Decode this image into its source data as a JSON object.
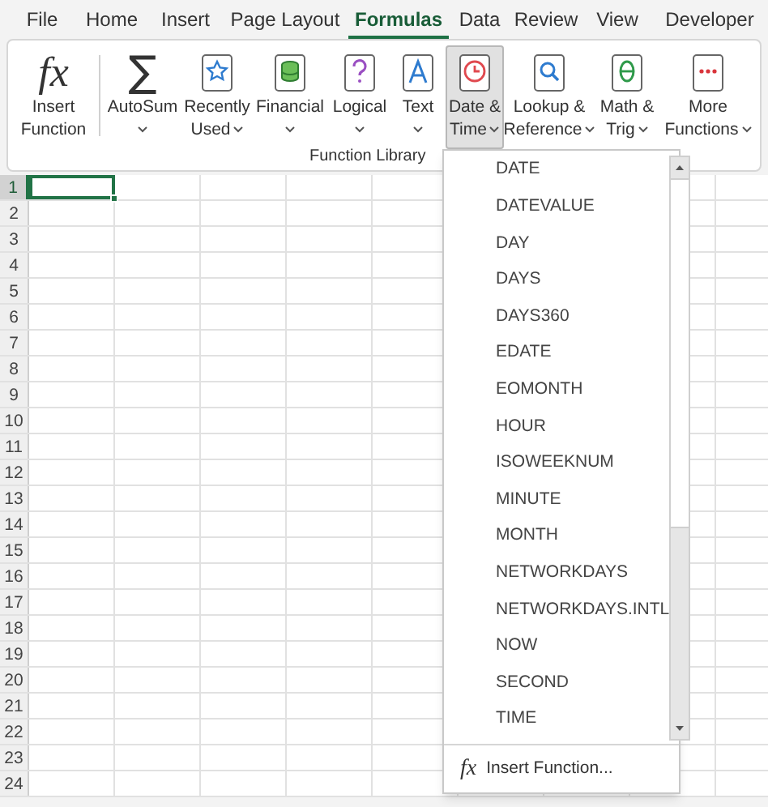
{
  "tabs": [
    {
      "label": "File",
      "selected": false
    },
    {
      "label": "Home",
      "selected": false
    },
    {
      "label": "Insert",
      "selected": false
    },
    {
      "label": "Page Layout",
      "selected": false
    },
    {
      "label": "Formulas",
      "selected": true
    },
    {
      "label": "Data",
      "selected": false
    },
    {
      "label": "Review",
      "selected": false
    },
    {
      "label": "View",
      "selected": false
    },
    {
      "label": "Developer",
      "selected": false
    }
  ],
  "ribbon": {
    "group_label": "Function Library",
    "buttons": [
      {
        "kind": "glyph",
        "glyph": "fx",
        "label": [
          "Insert",
          "Function"
        ],
        "caret": false,
        "pressed": false
      },
      {
        "kind": "glyph",
        "glyph": "∑",
        "label": [
          "AutoSum"
        ],
        "caret": true,
        "pressed": false
      },
      {
        "kind": "book",
        "label": [
          "Recently",
          "Used"
        ],
        "caret": true,
        "pressed": false
      },
      {
        "kind": "book",
        "label": [
          "Financial"
        ],
        "caret": true,
        "pressed": false
      },
      {
        "kind": "book",
        "label": [
          "Logical"
        ],
        "caret": true,
        "pressed": false
      },
      {
        "kind": "book",
        "label": [
          "Text"
        ],
        "caret": true,
        "pressed": false
      },
      {
        "kind": "book",
        "label": [
          "Date &",
          "Time"
        ],
        "caret": true,
        "pressed": true
      },
      {
        "kind": "book",
        "label": [
          "Lookup &",
          "Reference"
        ],
        "caret": true,
        "pressed": false
      },
      {
        "kind": "book",
        "label": [
          "Math &",
          "Trig"
        ],
        "caret": true,
        "pressed": false
      },
      {
        "kind": "book",
        "label": [
          "More",
          "Functions"
        ],
        "caret": true,
        "pressed": false
      }
    ]
  },
  "grid": {
    "rows": [
      {
        "number": "1",
        "selected": true
      },
      {
        "number": "2",
        "selected": false
      },
      {
        "number": "3",
        "selected": false
      },
      {
        "number": "4",
        "selected": false
      },
      {
        "number": "5",
        "selected": false
      },
      {
        "number": "6",
        "selected": false
      },
      {
        "number": "7",
        "selected": false
      },
      {
        "number": "8",
        "selected": false
      },
      {
        "number": "9",
        "selected": false
      },
      {
        "number": "10",
        "selected": false
      },
      {
        "number": "11",
        "selected": false
      },
      {
        "number": "12",
        "selected": false
      },
      {
        "number": "13",
        "selected": false
      },
      {
        "number": "14",
        "selected": false
      },
      {
        "number": "15",
        "selected": false
      },
      {
        "number": "16",
        "selected": false
      },
      {
        "number": "17",
        "selected": false
      },
      {
        "number": "18",
        "selected": false
      },
      {
        "number": "19",
        "selected": false
      },
      {
        "number": "20",
        "selected": false
      },
      {
        "number": "21",
        "selected": false
      },
      {
        "number": "22",
        "selected": false
      },
      {
        "number": "23",
        "selected": false
      },
      {
        "number": "24",
        "selected": false
      }
    ]
  },
  "dropdown": {
    "items": [
      "DATE",
      "DATEVALUE",
      "DAY",
      "DAYS",
      "DAYS360",
      "EDATE",
      "EOMONTH",
      "HOUR",
      "ISOWEEKNUM",
      "MINUTE",
      "MONTH",
      "NETWORKDAYS",
      "NETWORKDAYS.INTL",
      "NOW",
      "SECOND",
      "TIME"
    ],
    "footer": {
      "glyph": "fx",
      "label": "Insert Function..."
    }
  }
}
